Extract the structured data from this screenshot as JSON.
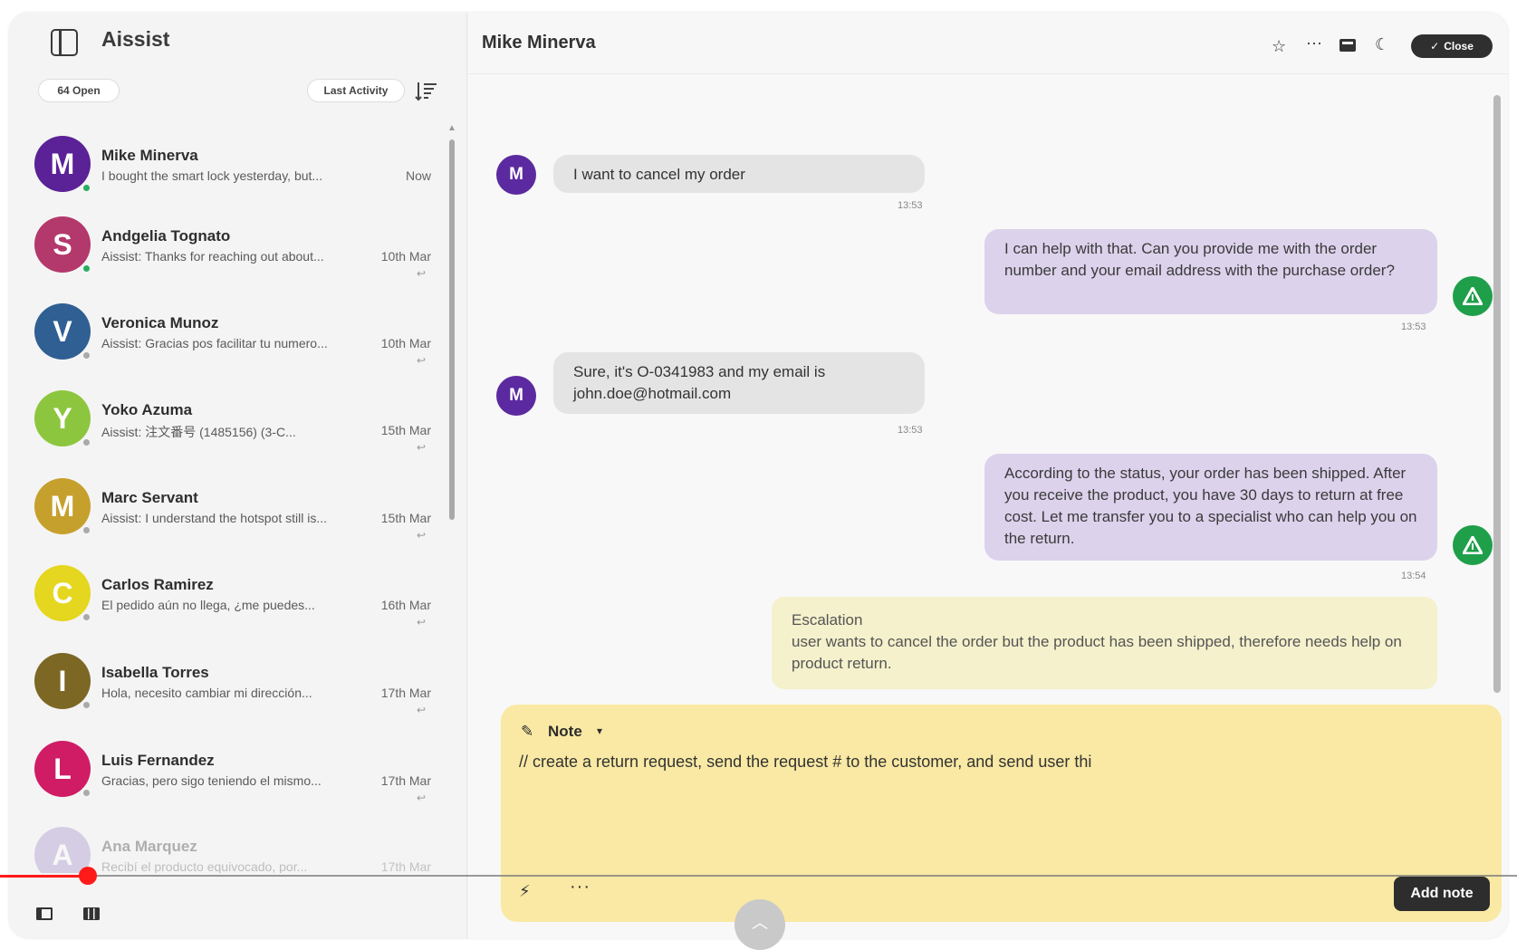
{
  "app": {
    "name": "Aissist"
  },
  "sidebar": {
    "open_label": "64 Open",
    "sort_label": "Last Activity",
    "conversations": [
      {
        "name": "Mike Minerva",
        "initial": "M",
        "preview": "I bought the smart lock yesterday, but...",
        "time": "Now",
        "reply": "",
        "color": "#5b2197",
        "status_color": "#27ae60"
      },
      {
        "name": "Andgelia Tognato",
        "initial": "S",
        "preview": "Aissist: Thanks for reaching out about...",
        "time": "10th Mar",
        "reply": "↩",
        "color": "#b3386b",
        "status_color": "#27ae60"
      },
      {
        "name": "Veronica Munoz",
        "initial": "V",
        "preview": "Aissist: Gracias pos facilitar tu numero...",
        "time": "10th Mar",
        "reply": "↩",
        "color": "#2f5f93",
        "status_color": "#aaaaaa"
      },
      {
        "name": "Yoko Azuma",
        "initial": "Y",
        "preview": "Aissist: 注文番号 (1485156) (3-C...",
        "time": "15th Mar",
        "reply": "↩",
        "color": "#8cc63f",
        "status_color": "#aaaaaa"
      },
      {
        "name": "Marc Servant",
        "initial": "M",
        "preview": "Aissist: I understand the hotspot still is...",
        "time": "15th Mar",
        "reply": "↩",
        "color": "#c6a02c",
        "status_color": "#aaaaaa"
      },
      {
        "name": "Carlos Ramirez",
        "initial": "C",
        "preview": "El pedido aún no llega, ¿me puedes...",
        "time": "16th Mar",
        "reply": "↩",
        "color": "#e5d61f",
        "status_color": "#aaaaaa"
      },
      {
        "name": "Isabella Torres",
        "initial": "I",
        "preview": "Hola, necesito cambiar mi dirección...",
        "time": "17th Mar",
        "reply": "↩",
        "color": "#7d6725",
        "status_color": "#aaaaaa"
      },
      {
        "name": "Luis Fernandez",
        "initial": "L",
        "preview": "Gracias, pero sigo teniendo el mismo...",
        "time": "17th Mar",
        "reply": "↩",
        "color": "#d01c65",
        "status_color": "#aaaaaa"
      },
      {
        "name": "Ana Marquez",
        "initial": "A",
        "preview": "Recibí el producto equivocado, por...",
        "time": "17th Mar",
        "reply": "",
        "color": "#9c86c8",
        "status_color": "#aaaaaa"
      }
    ]
  },
  "main": {
    "title": "Mike Minerva",
    "close_label": "Close",
    "messages": [
      {
        "from": "user",
        "initial": "M",
        "text": "I want to cancel my order",
        "time": "13:53"
      },
      {
        "from": "bot",
        "text": "I can help with that. Can you provide me with the order number and your email address with the purchase order?",
        "time": "13:53"
      },
      {
        "from": "user",
        "initial": "M",
        "text": "Sure, it's O-0341983 and my email is john.doe@hotmail.com",
        "time": "13:53"
      },
      {
        "from": "bot",
        "text": "According to the status, your order has been shipped. After you receive the product, you have 30 days to return at free cost. Let me transfer you to a specialist who can help you on the return.",
        "time": "13:54"
      }
    ],
    "escalation": {
      "title": "Escalation",
      "text": "user wants to cancel the order but the product has been shipped, therefore needs help on product return."
    },
    "composer": {
      "mode": "Note",
      "value": "// create a return request, send the request # to the customer, and send user thi",
      "add_label": "Add note"
    }
  },
  "video": {
    "progress": 0.058
  }
}
